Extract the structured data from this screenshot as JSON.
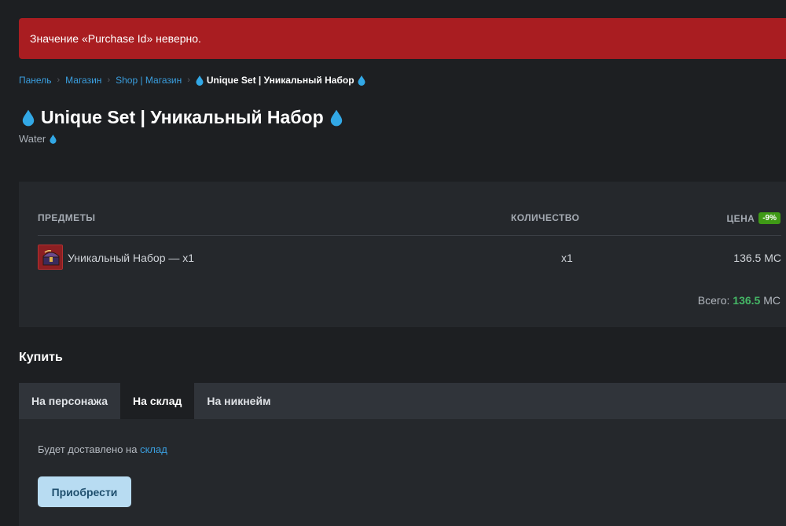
{
  "error": {
    "message": "Значение «Purchase Id» неверно."
  },
  "breadcrumb": {
    "items": [
      "Панель",
      "Магазин",
      "Shop | Магазин"
    ],
    "separator": "›",
    "current": "Unique Set | Уникальный Набор"
  },
  "page": {
    "title": "Unique Set | Уникальный Набор",
    "subtitle": "Water"
  },
  "items_table": {
    "headers": {
      "items": "ПРЕДМЕТЫ",
      "quantity": "КОЛИЧЕСТВО",
      "price": "ЦЕНА"
    },
    "discount_badge": "-9%",
    "rows": [
      {
        "name": "Уникальный Набор — x1",
        "quantity": "x1",
        "price": "136.5 MC"
      }
    ],
    "total": {
      "label": "Всего: ",
      "value": "136.5",
      "currency": " MC"
    }
  },
  "buy": {
    "heading": "Купить",
    "tabs": [
      "На персонажа",
      "На склад",
      "На никнейм"
    ],
    "active_tab": "На склад",
    "delivery_text": "Будет доставлено на ",
    "delivery_link": "склад",
    "button_label": "Приобрести"
  },
  "icons": [
    "water-drop-icon",
    "item-chest-icon",
    "chevron-right-icon"
  ],
  "colors": {
    "error_bg": "#a91d21",
    "link": "#3a9fe0",
    "discount_bg": "#3f9a16",
    "total_value": "#45b866",
    "button_bg": "#b8dcf2",
    "drop": "#32a8e6"
  }
}
